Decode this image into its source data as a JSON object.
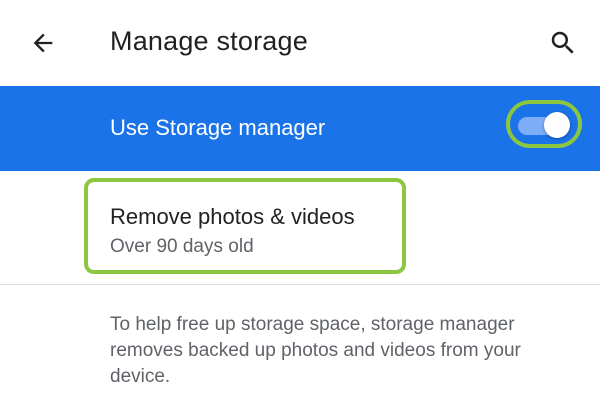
{
  "appbar": {
    "title": "Manage storage",
    "back_icon": "arrow-back-icon",
    "search_icon": "search-icon"
  },
  "master_switch": {
    "label": "Use Storage manager",
    "checked": true,
    "row_color": "#1a73e8"
  },
  "preference": {
    "title": "Remove photos & videos",
    "summary": "Over 90 days old"
  },
  "footer": {
    "text": "To help free up storage space, storage manager removes backed up photos and videos from your device."
  },
  "colors": {
    "highlight": "#8dc63f",
    "primary": "#1a73e8"
  }
}
